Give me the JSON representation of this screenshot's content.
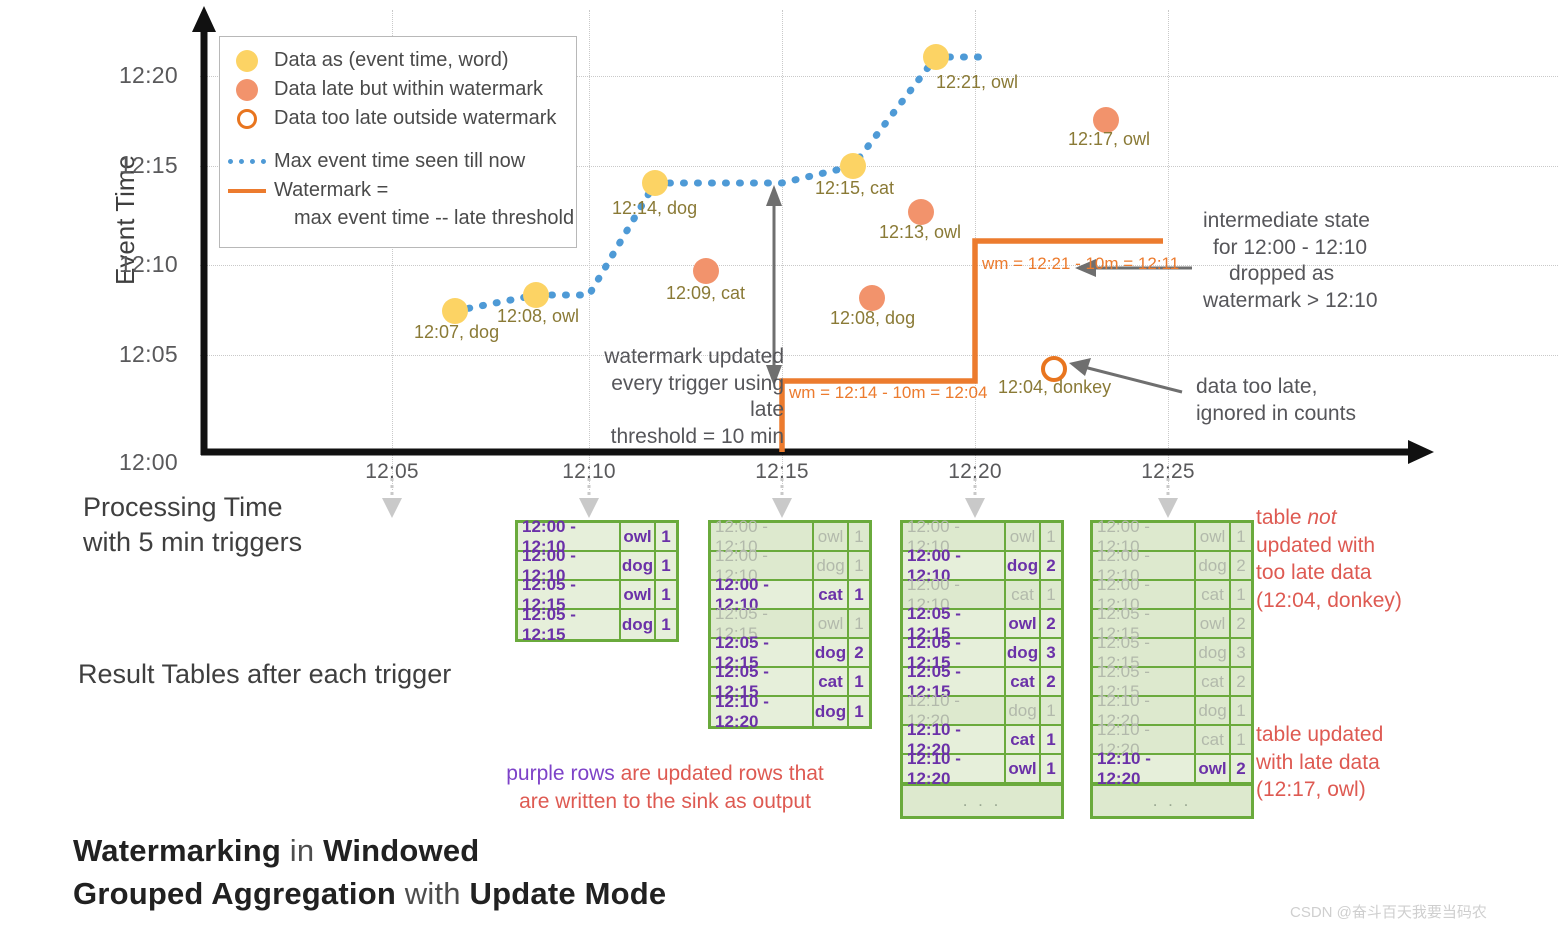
{
  "axes": {
    "y_label": "Event Time",
    "y_ticks": [
      "12:20",
      "12:15",
      "12:10",
      "12:05",
      "12:00"
    ],
    "x_ticks": [
      "12:05",
      "12:10",
      "12:15",
      "12:20",
      "12:25"
    ]
  },
  "legend": {
    "items": [
      {
        "icon": "yellow-filled-circle-icon",
        "label": "Data as (event time, word)"
      },
      {
        "icon": "orange-filled-circle-icon",
        "label": "Data late but within watermark"
      },
      {
        "icon": "orange-hollow-circle-icon",
        "label": "Data too late outside watermark"
      },
      {
        "icon": "blue-dotted-line-icon",
        "label": "Max event time seen till now"
      },
      {
        "icon": "orange-solid-line-icon",
        "label": "Watermark ="
      },
      {
        "icon": "none",
        "label": "max event time -- late threshold"
      }
    ]
  },
  "points": [
    {
      "label": "12:07, dog",
      "kind": "yellow"
    },
    {
      "label": "12:08, owl",
      "kind": "yellow"
    },
    {
      "label": "12:14, dog",
      "kind": "yellow"
    },
    {
      "label": "12:09, cat",
      "kind": "orange"
    },
    {
      "label": "12:15, cat",
      "kind": "yellow"
    },
    {
      "label": "12:21, owl",
      "kind": "yellow"
    },
    {
      "label": "12:13, owl",
      "kind": "orange"
    },
    {
      "label": "12:17, owl",
      "kind": "orange"
    },
    {
      "label": "12:08, dog",
      "kind": "orange"
    },
    {
      "label": "12:04, donkey",
      "kind": "hollow"
    }
  ],
  "watermark_labels": {
    "first": "wm = 12:14 - 10m = 12:04",
    "second": "wm = 12:21 - 10m = 12:11"
  },
  "annotations": {
    "watermark_updated": [
      "watermark updated",
      "every trigger using late",
      "threshold = 10 min"
    ],
    "intermediate_state": [
      "intermediate state",
      "for 12:00 - 12:10",
      "dropped as",
      "watermark > 12:10"
    ],
    "data_too_late": [
      "data too late,",
      "ignored in counts"
    ],
    "processing_time": [
      "Processing Time",
      "with 5 min triggers"
    ],
    "result_tables": "Result Tables after each trigger",
    "purple_rows_prefix": "purple rows",
    "purple_rows_rest": " are updated rows that",
    "purple_rows_line2": "are written to the sink as output",
    "table_not_updated": {
      "l1a": "table ",
      "l1b": "not",
      "l2": "updated with",
      "l3": "too late data",
      "l4": "(12:04, donkey)"
    },
    "table_updated": [
      "table updated",
      "with late data",
      "(12:17, owl)"
    ]
  },
  "title": {
    "line1": [
      {
        "t": "Watermarking",
        "w": "b"
      },
      {
        "t": " in ",
        "w": "l"
      },
      {
        "t": "Windowed",
        "w": "b"
      }
    ],
    "line2": [
      {
        "t": "Grouped Aggregation",
        "w": "b"
      },
      {
        "t": " with ",
        "w": "l"
      },
      {
        "t": "Update Mode",
        "w": "b"
      }
    ]
  },
  "watermark_credit": "CSDN @奋斗百天我要当码农",
  "tables": [
    {
      "name": "result-table-trigger-1",
      "rows": [
        {
          "window": "12:00 - 12:10",
          "word": "owl",
          "count": "1",
          "state": "purple"
        },
        {
          "window": "12:00 - 12:10",
          "word": "dog",
          "count": "1",
          "state": "purple"
        },
        {
          "window": "12:05 - 12:15",
          "word": "owl",
          "count": "1",
          "state": "purple"
        },
        {
          "window": "12:05 - 12:15",
          "word": "dog",
          "count": "1",
          "state": "purple"
        }
      ],
      "ellipsis": false
    },
    {
      "name": "result-table-trigger-2",
      "rows": [
        {
          "window": "12:00 - 12:10",
          "word": "owl",
          "count": "1",
          "state": "gray"
        },
        {
          "window": "12:00 - 12:10",
          "word": "dog",
          "count": "1",
          "state": "gray"
        },
        {
          "window": "12:00 - 12:10",
          "word": "cat",
          "count": "1",
          "state": "purple"
        },
        {
          "window": "12:05 - 12:15",
          "word": "owl",
          "count": "1",
          "state": "gray"
        },
        {
          "window": "12:05 - 12:15",
          "word": "dog",
          "count": "2",
          "state": "purple"
        },
        {
          "window": "12:05 - 12:15",
          "word": "cat",
          "count": "1",
          "state": "purple"
        },
        {
          "window": "12:10 - 12:20",
          "word": "dog",
          "count": "1",
          "state": "purple"
        }
      ],
      "ellipsis": false
    },
    {
      "name": "result-table-trigger-3",
      "rows": [
        {
          "window": "12:00 - 12:10",
          "word": "owl",
          "count": "1",
          "state": "gray"
        },
        {
          "window": "12:00 - 12:10",
          "word": "dog",
          "count": "2",
          "state": "purple"
        },
        {
          "window": "12:00 - 12:10",
          "word": "cat",
          "count": "1",
          "state": "gray"
        },
        {
          "window": "12:05 - 12:15",
          "word": "owl",
          "count": "2",
          "state": "purple"
        },
        {
          "window": "12:05 - 12:15",
          "word": "dog",
          "count": "3",
          "state": "purple"
        },
        {
          "window": "12:05 - 12:15",
          "word": "cat",
          "count": "2",
          "state": "purple"
        },
        {
          "window": "12:10 - 12:20",
          "word": "dog",
          "count": "1",
          "state": "gray"
        },
        {
          "window": "12:10 - 12:20",
          "word": "cat",
          "count": "1",
          "state": "purple"
        },
        {
          "window": "12:10 - 12:20",
          "word": "owl",
          "count": "1",
          "state": "purple"
        }
      ],
      "ellipsis": true
    },
    {
      "name": "result-table-trigger-4",
      "rows": [
        {
          "window": "12:00 - 12:10",
          "word": "owl",
          "count": "1",
          "state": "gray"
        },
        {
          "window": "12:00 - 12:10",
          "word": "dog",
          "count": "2",
          "state": "gray"
        },
        {
          "window": "12:00 - 12:10",
          "word": "cat",
          "count": "1",
          "state": "gray"
        },
        {
          "window": "12:05 - 12:15",
          "word": "owl",
          "count": "2",
          "state": "gray"
        },
        {
          "window": "12:05 - 12:15",
          "word": "dog",
          "count": "3",
          "state": "gray"
        },
        {
          "window": "12:05 - 12:15",
          "word": "cat",
          "count": "2",
          "state": "gray"
        },
        {
          "window": "12:10 - 12:20",
          "word": "dog",
          "count": "1",
          "state": "gray"
        },
        {
          "window": "12:10 - 12:20",
          "word": "cat",
          "count": "1",
          "state": "gray"
        },
        {
          "window": "12:10 - 12:20",
          "word": "owl",
          "count": "2",
          "state": "purple"
        }
      ],
      "ellipsis": true
    }
  ],
  "chart_data": {
    "type": "scatter",
    "title": "Watermarking in Windowed Grouped Aggregation with Update Mode",
    "xlabel": "Processing Time with 5 min triggers",
    "ylabel": "Event Time",
    "xlim": [
      "12:00",
      "12:27"
    ],
    "ylim": [
      "12:00",
      "12:22"
    ],
    "grid": true,
    "legend_position": "top-left",
    "points": [
      {
        "processing_time": "12:06",
        "event_time": "12:07",
        "word": "dog",
        "kind": "on-time"
      },
      {
        "processing_time": "12:08",
        "event_time": "12:08",
        "word": "owl",
        "kind": "on-time"
      },
      {
        "processing_time": "12:11",
        "event_time": "12:14",
        "word": "dog",
        "kind": "on-time"
      },
      {
        "processing_time": "12:13",
        "event_time": "12:09",
        "word": "cat",
        "kind": "late-within-watermark"
      },
      {
        "processing_time": "12:16",
        "event_time": "12:15",
        "word": "cat",
        "kind": "on-time"
      },
      {
        "processing_time": "12:19",
        "event_time": "12:21",
        "word": "owl",
        "kind": "on-time"
      },
      {
        "processing_time": "12:18",
        "event_time": "12:13",
        "word": "owl",
        "kind": "late-within-watermark"
      },
      {
        "processing_time": "12:23",
        "event_time": "12:17",
        "word": "owl",
        "kind": "late-within-watermark"
      },
      {
        "processing_time": "12:17",
        "event_time": "12:08",
        "word": "dog",
        "kind": "late-within-watermark"
      },
      {
        "processing_time": "12:22",
        "event_time": "12:04",
        "word": "donkey",
        "kind": "too-late"
      }
    ],
    "series": [
      {
        "name": "Max event time seen till now",
        "style": "dotted",
        "color": "#4e9ad6",
        "x": [
          "12:06",
          "12:08",
          "12:10",
          "12:11",
          "12:16",
          "12:16",
          "12:19",
          "12:20"
        ],
        "y": [
          "12:07",
          "12:08",
          "12:08",
          "12:14",
          "12:14",
          "12:15",
          "12:21",
          "12:21"
        ]
      },
      {
        "name": "Watermark = max event time -- late threshold",
        "style": "step",
        "color": "#ec7b2e",
        "x": [
          "12:15",
          "12:15",
          "12:20",
          "12:20",
          "12:25"
        ],
        "y": [
          "12:00",
          "12:04",
          "12:04",
          "12:11",
          "12:11"
        ]
      }
    ]
  }
}
